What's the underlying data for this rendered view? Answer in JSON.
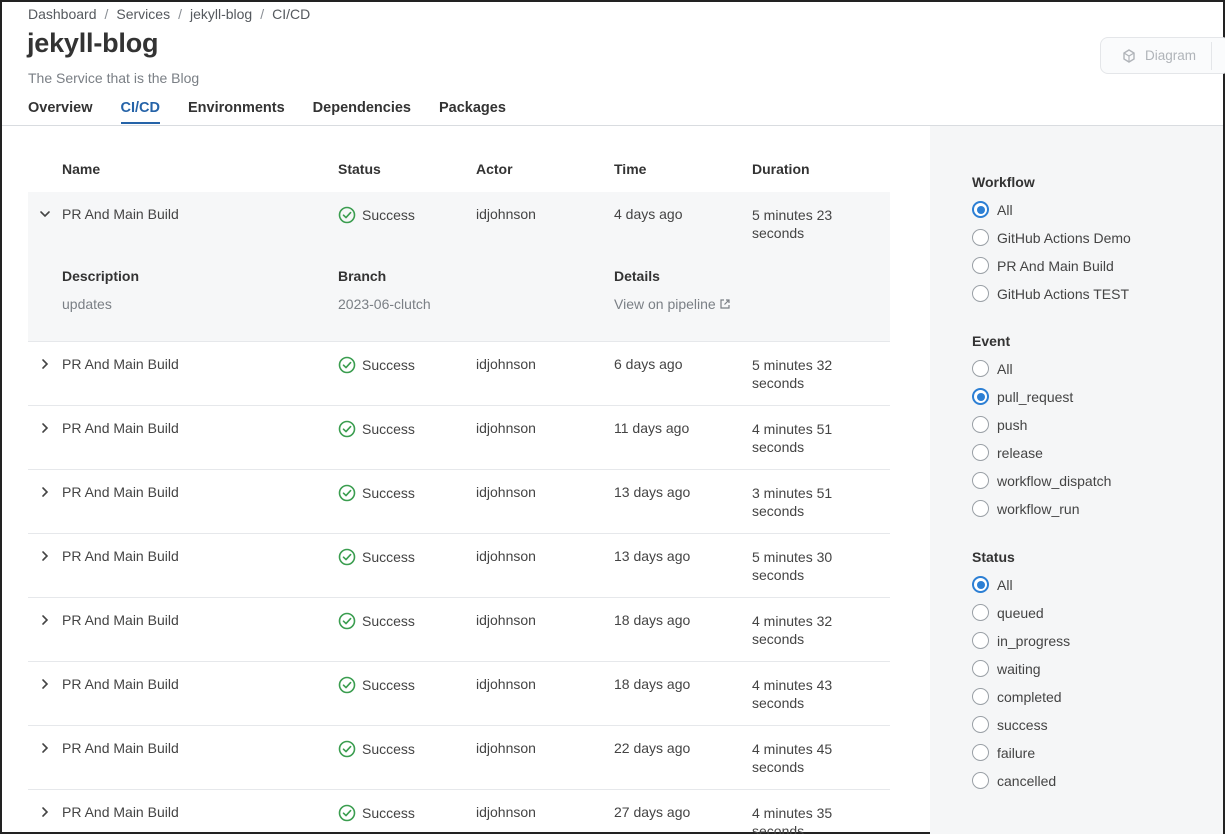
{
  "breadcrumb": [
    "Dashboard",
    "Services",
    "jekyll-blog",
    "CI/CD"
  ],
  "breadcrumb_separator": "/",
  "title": "jekyll-blog",
  "subtitle": "The Service that is the Blog",
  "tabs": [
    {
      "label": "Overview",
      "active": false
    },
    {
      "label": "CI/CD",
      "active": true
    },
    {
      "label": "Environments",
      "active": false
    },
    {
      "label": "Dependencies",
      "active": false
    },
    {
      "label": "Packages",
      "active": false
    }
  ],
  "diagram_button": {
    "label": "Diagram",
    "icon": "diagram-icon"
  },
  "table": {
    "headers": {
      "name": "Name",
      "status": "Status",
      "actor": "Actor",
      "time": "Time",
      "duration": "Duration"
    },
    "expanded_details": {
      "description_label": "Description",
      "description": "updates",
      "branch_label": "Branch",
      "branch": "2023-06-clutch",
      "details_label": "Details",
      "details_link": "View on pipeline"
    },
    "rows": [
      {
        "name": "PR And Main Build",
        "status": "Success",
        "actor": "idjohnson",
        "time": "4 days ago",
        "duration_line1": "5 minutes 23",
        "duration_line2": "seconds",
        "expanded": true
      },
      {
        "name": "PR And Main Build",
        "status": "Success",
        "actor": "idjohnson",
        "time": "6 days ago",
        "duration_line1": "5 minutes 32",
        "duration_line2": "seconds",
        "expanded": false
      },
      {
        "name": "PR And Main Build",
        "status": "Success",
        "actor": "idjohnson",
        "time": "11 days ago",
        "duration_line1": "4 minutes 51",
        "duration_line2": "seconds",
        "expanded": false
      },
      {
        "name": "PR And Main Build",
        "status": "Success",
        "actor": "idjohnson",
        "time": "13 days ago",
        "duration_line1": "3 minutes 51",
        "duration_line2": "seconds",
        "expanded": false
      },
      {
        "name": "PR And Main Build",
        "status": "Success",
        "actor": "idjohnson",
        "time": "13 days ago",
        "duration_line1": "5 minutes 30",
        "duration_line2": "seconds",
        "expanded": false
      },
      {
        "name": "PR And Main Build",
        "status": "Success",
        "actor": "idjohnson",
        "time": "18 days ago",
        "duration_line1": "4 minutes 32",
        "duration_line2": "seconds",
        "expanded": false
      },
      {
        "name": "PR And Main Build",
        "status": "Success",
        "actor": "idjohnson",
        "time": "18 days ago",
        "duration_line1": "4 minutes 43",
        "duration_line2": "seconds",
        "expanded": false
      },
      {
        "name": "PR And Main Build",
        "status": "Success",
        "actor": "idjohnson",
        "time": "22 days ago",
        "duration_line1": "4 minutes 45",
        "duration_line2": "seconds",
        "expanded": false
      },
      {
        "name": "PR And Main Build",
        "status": "Success",
        "actor": "idjohnson",
        "time": "27 days ago",
        "duration_line1": "4 minutes 35",
        "duration_line2": "seconds",
        "expanded": false
      }
    ]
  },
  "filters": {
    "workflow": {
      "title": "Workflow",
      "options": [
        {
          "label": "All",
          "selected": true
        },
        {
          "label": "GitHub Actions Demo",
          "selected": false
        },
        {
          "label": "PR And Main Build",
          "selected": false
        },
        {
          "label": "GitHub Actions TEST",
          "selected": false
        }
      ]
    },
    "event": {
      "title": "Event",
      "options": [
        {
          "label": "All",
          "selected": false
        },
        {
          "label": "pull_request",
          "selected": true
        },
        {
          "label": "push",
          "selected": false
        },
        {
          "label": "release",
          "selected": false
        },
        {
          "label": "workflow_dispatch",
          "selected": false
        },
        {
          "label": "workflow_run",
          "selected": false
        }
      ]
    },
    "status": {
      "title": "Status",
      "options": [
        {
          "label": "All",
          "selected": true
        },
        {
          "label": "queued",
          "selected": false
        },
        {
          "label": "in_progress",
          "selected": false
        },
        {
          "label": "waiting",
          "selected": false
        },
        {
          "label": "completed",
          "selected": false
        },
        {
          "label": "success",
          "selected": false
        },
        {
          "label": "failure",
          "selected": false
        },
        {
          "label": "cancelled",
          "selected": false
        }
      ]
    }
  },
  "colors": {
    "accent": "#2563a8",
    "radio": "#2c7fd4",
    "success": "#3a9d4f"
  }
}
